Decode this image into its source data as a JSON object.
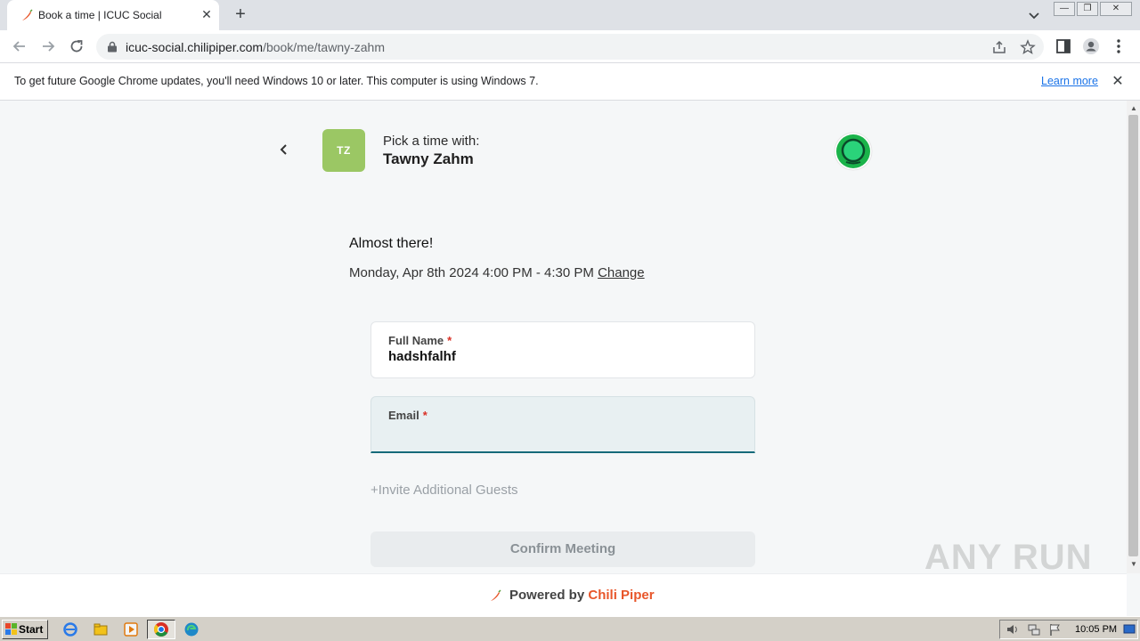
{
  "browser": {
    "tab_title": "Book a time | ICUC Social",
    "url_host": "icuc-social.chilipiper.com",
    "url_path": "/book/me/tawny-zahm",
    "window_controls": {
      "minimize": "—",
      "maximize": "❐",
      "close": "✕"
    }
  },
  "infobar": {
    "message": "To get future Google Chrome updates, you'll need Windows 10 or later. This computer is using Windows 7.",
    "learn_more": "Learn more"
  },
  "booking": {
    "avatar_initials": "TZ",
    "pick_label": "Pick a time with:",
    "host_name": "Tawny Zahm",
    "heading": "Almost there!",
    "datetime": "Monday, Apr 8th 2024 4:00 PM - 4:30 PM",
    "change_label": "Change",
    "fields": {
      "full_name": {
        "label": "Full Name",
        "required_mark": "*",
        "value": "hadshfalhf"
      },
      "email": {
        "label": "Email",
        "required_mark": "*",
        "value": ""
      }
    },
    "invite_label": "+Invite Additional Guests",
    "confirm_label": "Confirm Meeting"
  },
  "footer": {
    "powered_by": "Powered by",
    "brand": "Chili Piper"
  },
  "watermark": "ANY RUN",
  "taskbar": {
    "start_label": "Start",
    "clock": "10:05 PM"
  },
  "colors": {
    "avatar_bg": "#9bc764",
    "brand_orange": "#e8562a",
    "email_focus": "#166a7a",
    "link_blue": "#1a73e8"
  }
}
